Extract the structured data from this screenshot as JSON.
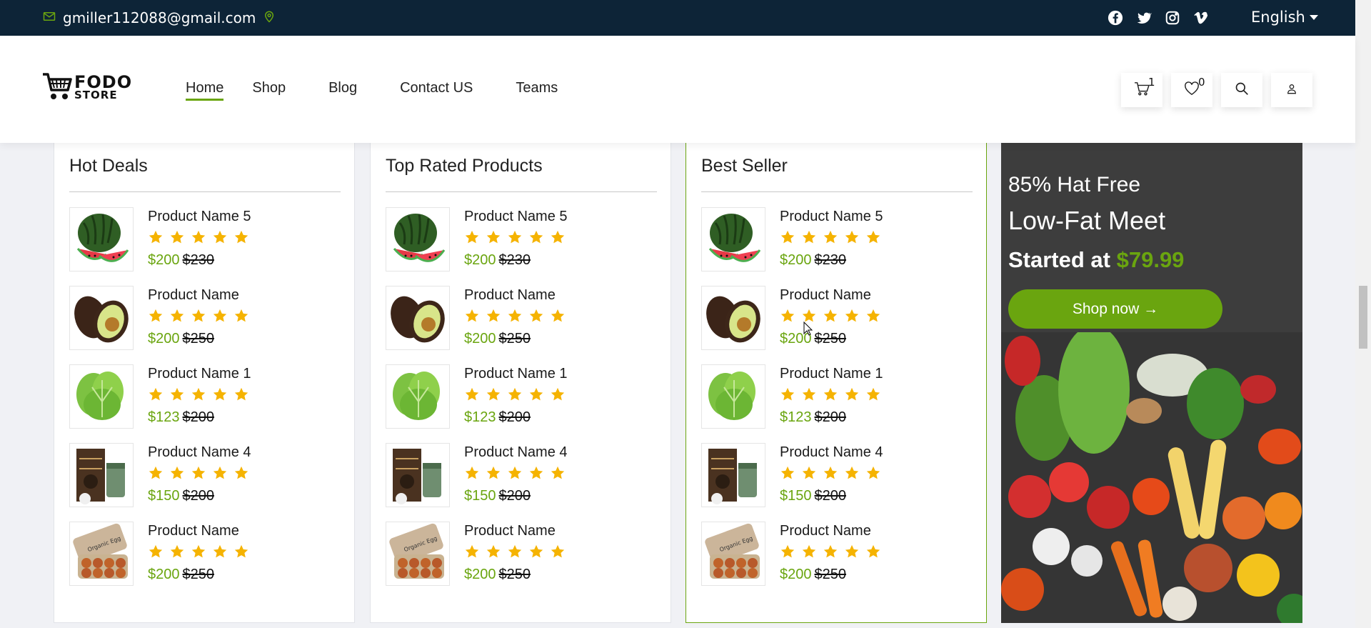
{
  "topbar": {
    "email": "gmiller112088@gmail.com",
    "social_icons": [
      "facebook-icon",
      "twitter-icon",
      "instagram-icon",
      "vimeo-icon"
    ],
    "language": "English"
  },
  "header": {
    "logo_line1": "FODO",
    "logo_line2": "STORE",
    "nav": [
      {
        "label": "Home",
        "active": true
      },
      {
        "label": "Shop",
        "active": false
      },
      {
        "label": "Blog",
        "active": false
      },
      {
        "label": "Contact US",
        "active": false
      },
      {
        "label": "Teams",
        "active": false
      }
    ],
    "cart_count": "1",
    "wishlist_count": "0"
  },
  "sections": [
    {
      "title": "Hot Deals",
      "products": [
        {
          "name": "Product Name 5",
          "image": "watermelon",
          "price": "$200",
          "old_price": "$230",
          "rating": 5
        },
        {
          "name": "Product Name",
          "image": "avocado",
          "price": "$200",
          "old_price": "$250",
          "rating": 5
        },
        {
          "name": "Product Name 1",
          "image": "lettuce",
          "price": "$123",
          "old_price": "$200",
          "rating": 5
        },
        {
          "name": "Product Name 4",
          "image": "tea-pack",
          "price": "$150",
          "old_price": "$200",
          "rating": 5
        },
        {
          "name": "Product Name",
          "image": "eggs",
          "price": "$200",
          "old_price": "$250",
          "rating": 5
        }
      ]
    },
    {
      "title": "Top Rated Products",
      "products": [
        {
          "name": "Product Name 5",
          "image": "watermelon",
          "price": "$200",
          "old_price": "$230",
          "rating": 5
        },
        {
          "name": "Product Name",
          "image": "avocado",
          "price": "$200",
          "old_price": "$250",
          "rating": 5
        },
        {
          "name": "Product Name 1",
          "image": "lettuce",
          "price": "$123",
          "old_price": "$200",
          "rating": 5
        },
        {
          "name": "Product Name 4",
          "image": "tea-pack",
          "price": "$150",
          "old_price": "$200",
          "rating": 5
        },
        {
          "name": "Product Name",
          "image": "eggs",
          "price": "$200",
          "old_price": "$250",
          "rating": 5
        }
      ]
    },
    {
      "title": "Best Seller",
      "products": [
        {
          "name": "Product Name 5",
          "image": "watermelon",
          "price": "$200",
          "old_price": "$230",
          "rating": 5
        },
        {
          "name": "Product Name",
          "image": "avocado",
          "price": "$200",
          "old_price": "$250",
          "rating": 5
        },
        {
          "name": "Product Name 1",
          "image": "lettuce",
          "price": "$123",
          "old_price": "$200",
          "rating": 5
        },
        {
          "name": "Product Name 4",
          "image": "tea-pack",
          "price": "$150",
          "old_price": "$200",
          "rating": 5
        },
        {
          "name": "Product Name",
          "image": "eggs",
          "price": "$200",
          "old_price": "$250",
          "rating": 5
        }
      ]
    }
  ],
  "banner": {
    "subtitle": "85% Hat Free",
    "title": "Low-Fat Meet",
    "started_label": "Started at",
    "started_price": "$79.99",
    "button_label": "Shop now →"
  },
  "colors": {
    "accent": "#6aa50f",
    "topbar": "#0d2437",
    "star": "#f5b301"
  }
}
